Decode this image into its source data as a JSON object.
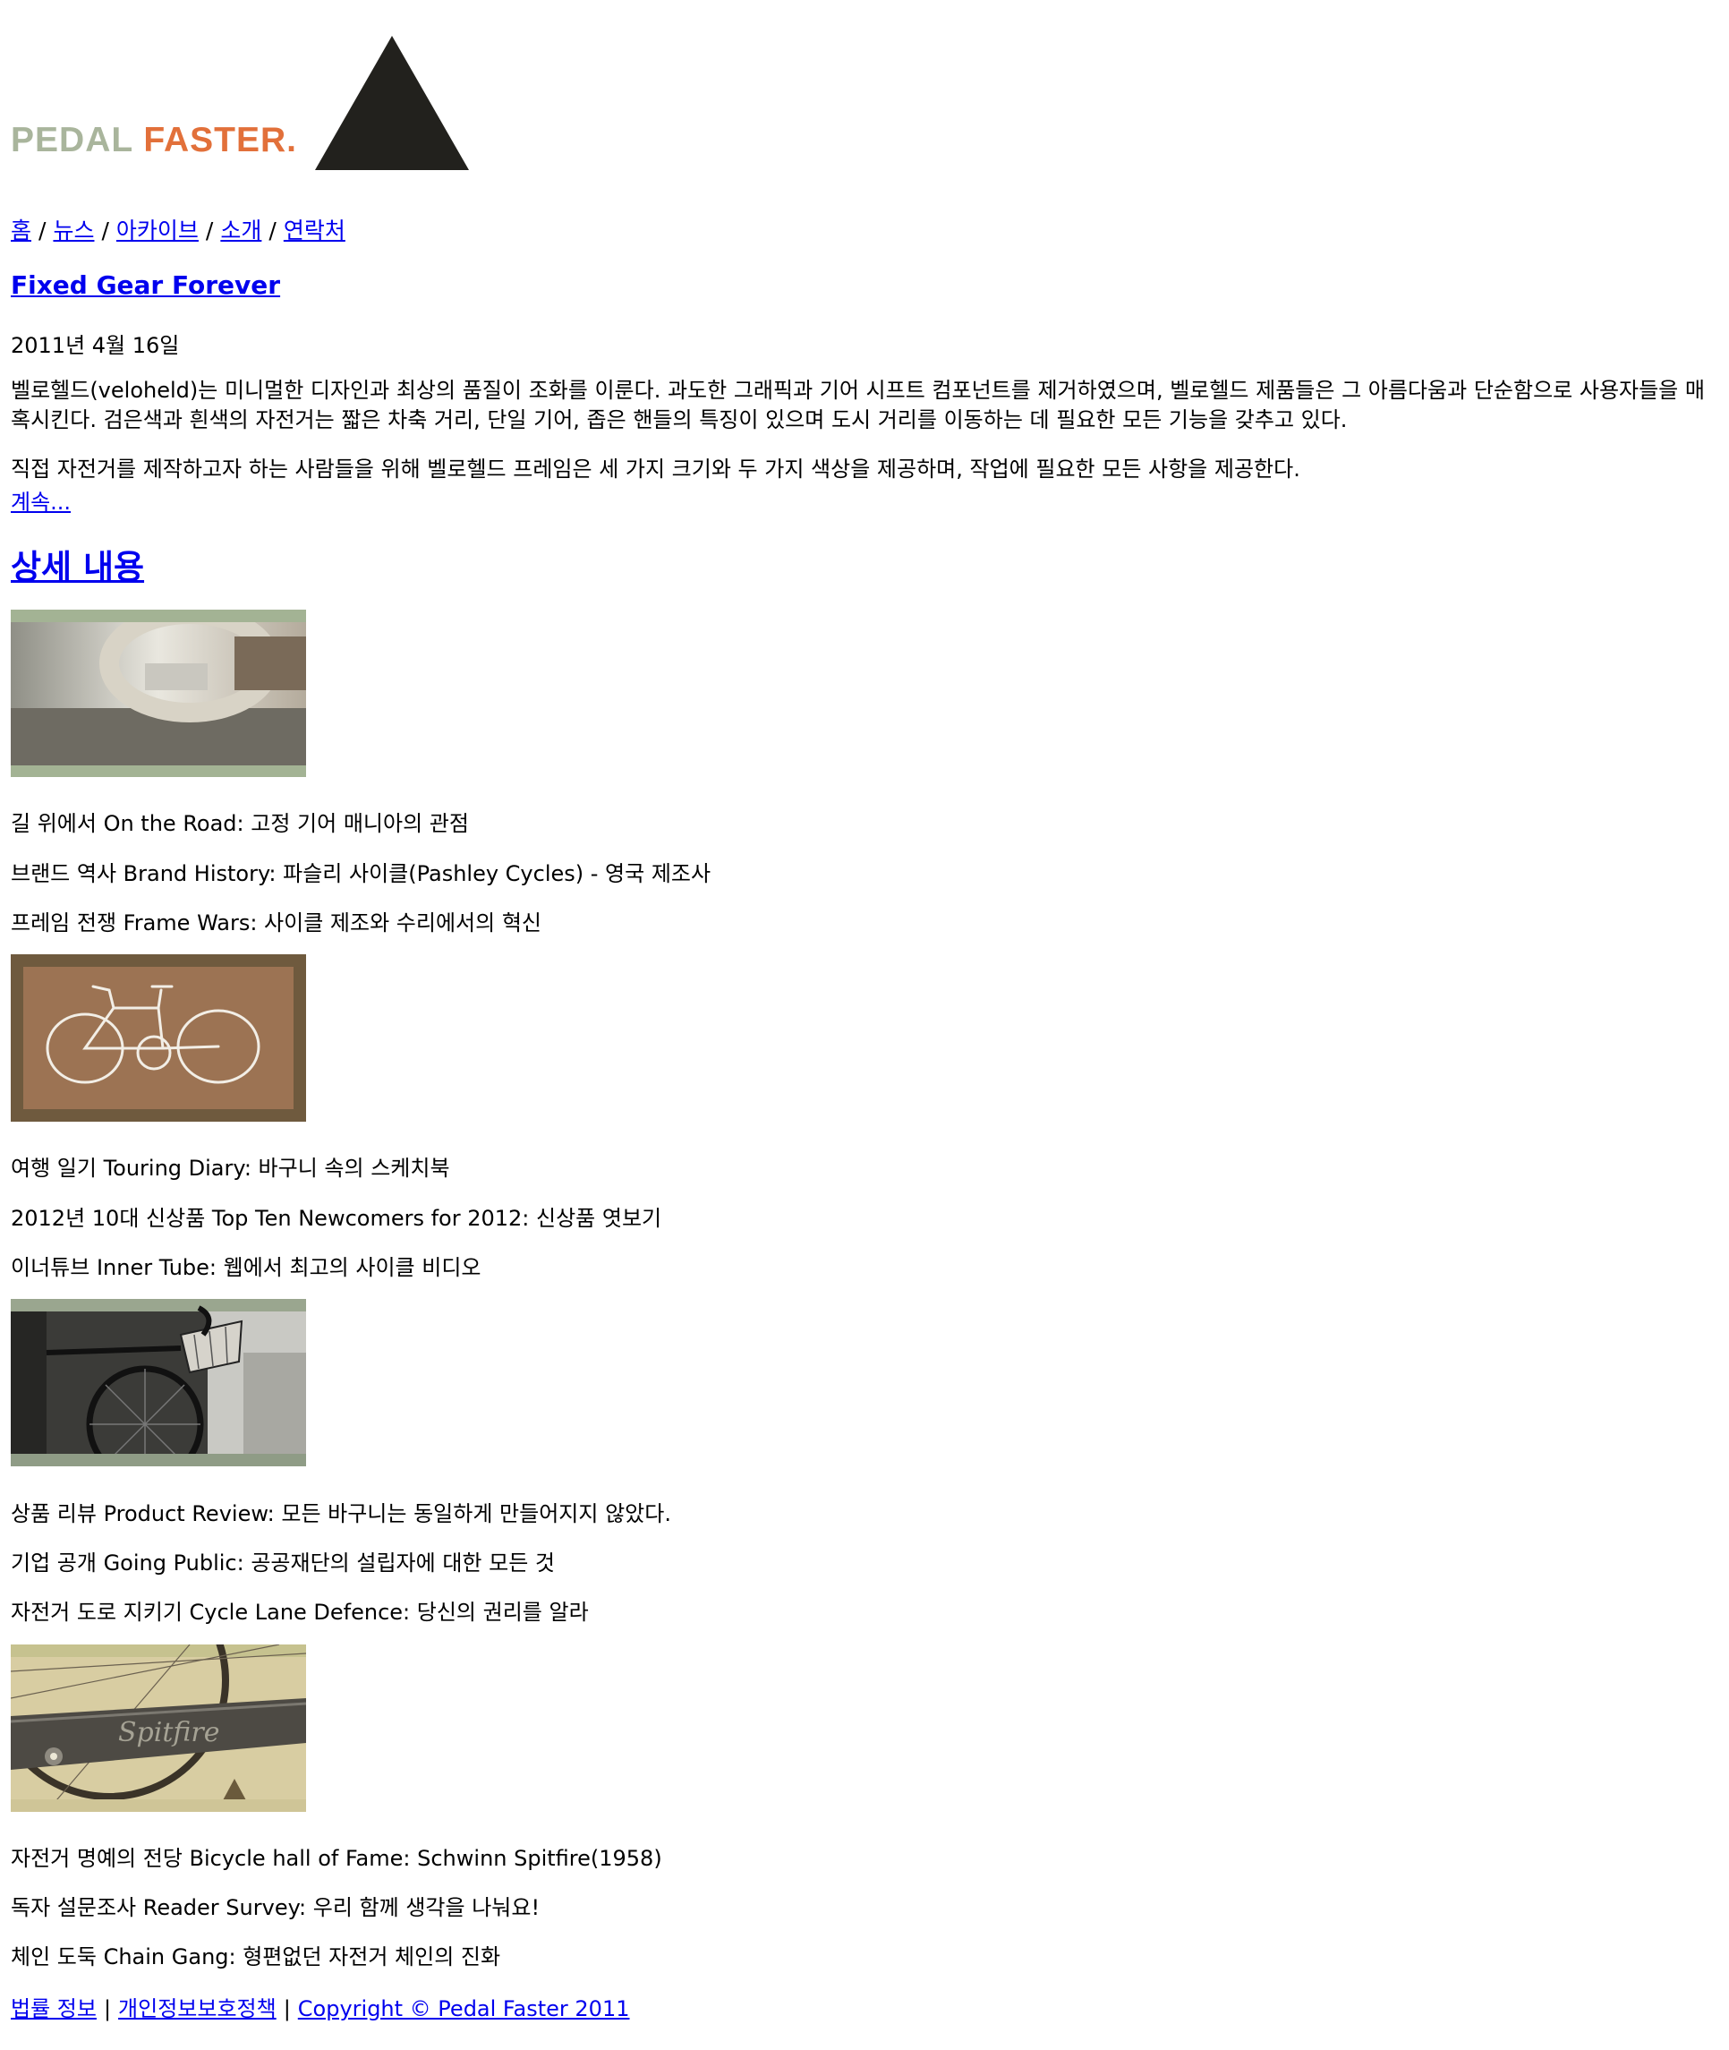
{
  "brand": {
    "logo_word1": "PEDAL",
    "logo_word2": "FASTER.",
    "logo_color1": "#a9b59c",
    "logo_color2": "#e2703a",
    "mark_color": "#22211d"
  },
  "nav": {
    "items": [
      "홈",
      "뉴스",
      "아카이브",
      "소개",
      "연락처"
    ],
    "separator": "/"
  },
  "post": {
    "title": "Fixed Gear Forever",
    "date": "2011년 4월 16일",
    "p1": "벨로헬드(veloheld)는 미니멀한 디자인과 최상의 품질이 조화를 이룬다. 과도한 그래픽과 기어 시프트 컴포넌트를 제거하였으며, 벨로헬드 제품들은 그 아름다움과 단순함으로 사용자들을 매혹시킨다. 검은색과 흰색의 자전거는 짧은 차축 거리, 단일 기어, 좁은 핸들의 특징이 있으며 도시 거리를 이동하는 데 필요한 모든 기능을 갖추고 있다.",
    "p2": "직접 자전거를 제작하고자 하는 사람들을 위해 벨로헬드 프레임은 세 가지 크기와 두 가지 색상을 제공하며, 작업에 필요한 모든 사항을 제공한다.",
    "more": "계속..."
  },
  "section": {
    "title": "상세 내용"
  },
  "groups": [
    {
      "image_icon": "bike-handlebar-photo",
      "items": [
        "길 위에서 On the Road: 고정 기어 매니아의 관점",
        "브랜드 역사 Brand History: 파슬리 사이클(Pashley Cycles) - 영국 제조사",
        "프레임 전쟁 Frame Wars: 사이클 제조와 수리에서의 혁신"
      ]
    },
    {
      "image_icon": "bike-sketch-drawing",
      "items": [
        "여행 일기 Touring Diary: 바구니 속의 스케치북",
        "2012년 10대 신상품 Top Ten Newcomers for 2012: 신상품 엿보기",
        "이너튜브 Inner Tube: 웹에서 최고의 사이클 비디오"
      ]
    },
    {
      "image_icon": "bike-basket-photo",
      "items": [
        "상품 리뷰 Product Review: 모든 바구니는 동일하게 만들어지지 않았다.",
        "기업 공개 Going Public: 공공재단의 설립자에 대한 모든 것",
        "자전거 도로 지키기 Cycle Lane Defence: 당신의 권리를 알라"
      ]
    },
    {
      "image_icon": "bike-chainguard-photo",
      "items": [
        "자전거 명예의 전당 Bicycle hall of Fame: Schwinn Spitfire(1958)",
        "독자 설문조사 Reader Survey: 우리 함께 생각을 나눠요!",
        "체인 도둑 Chain Gang: 형편없던 자전거 체인의 진화"
      ]
    }
  ],
  "thumb_text": {
    "chainguard": "Spitfire"
  },
  "footer": {
    "links": [
      "법률 정보",
      "개인정보보호정책",
      "Copyright © Pedal Faster 2011"
    ],
    "separator": "|"
  }
}
